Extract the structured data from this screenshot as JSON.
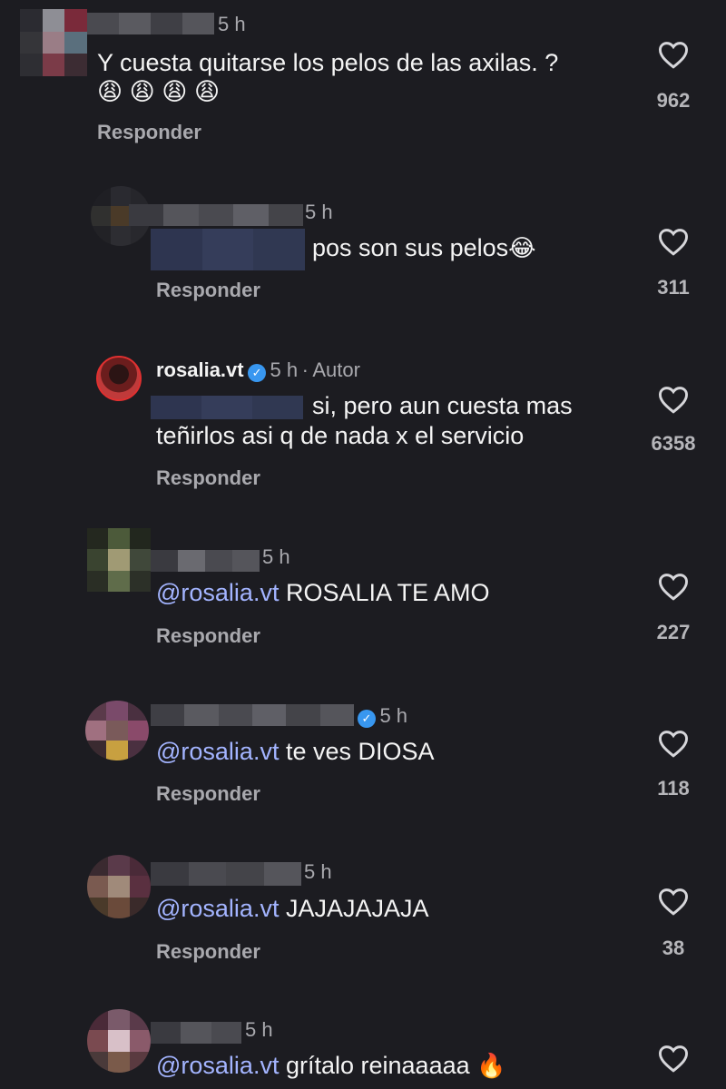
{
  "comments": [
    {
      "time": "5 h",
      "text": "Y cuesta quitarse los pelos de las axilas. ?",
      "emoji_line": "😩 😩 😩 😩",
      "reply_label": "Responder",
      "likes": "962"
    },
    {
      "time": "5 h",
      "text": "pos son sus pelos",
      "emoji": "😂",
      "reply_label": "Responder",
      "likes": "311"
    },
    {
      "author": "rosalia.vt",
      "time": "5 h",
      "separator": "·",
      "author_badge": "Autor",
      "text_line1": "si, pero aun cuesta mas",
      "text_line2": "teñirlos asi q de nada x el servicio",
      "reply_label": "Responder",
      "likes": "6358"
    },
    {
      "time": "5 h",
      "mention": "@rosalia.vt",
      "text": "ROSALIA TE AMO",
      "reply_label": "Responder",
      "likes": "227"
    },
    {
      "time": "5 h",
      "mention": "@rosalia.vt",
      "text": "te ves DIOSA",
      "reply_label": "Responder",
      "likes": "118"
    },
    {
      "time": "5 h",
      "mention": "@rosalia.vt",
      "text": "JAJAJAJAJA",
      "reply_label": "Responder",
      "likes": "38"
    },
    {
      "time": "5 h",
      "mention": "@rosalia.vt",
      "text": "grítalo reinaaaaa",
      "emoji": "🔥"
    }
  ],
  "colors": {
    "background": "#1c1c21",
    "mention": "#a3b4ff",
    "verified": "#3897f0",
    "secondary_text": "#a9a9ae"
  },
  "icons": [
    "heart-icon",
    "verified-badge-icon"
  ]
}
